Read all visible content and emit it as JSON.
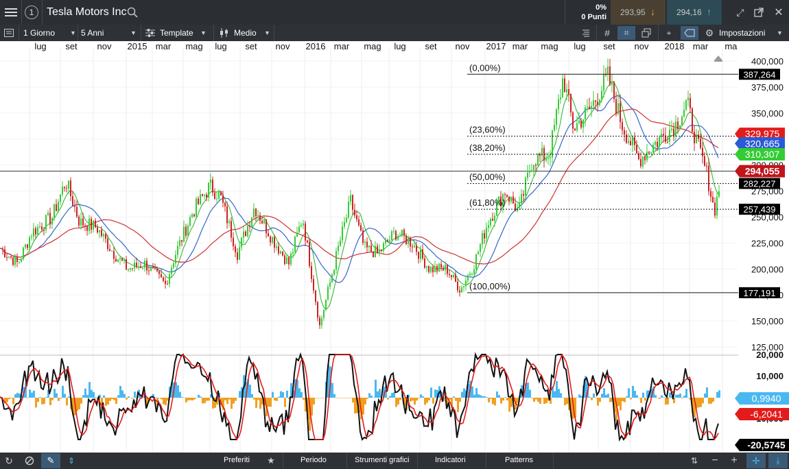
{
  "header": {
    "title": "Tesla Motors Inc",
    "change_pct": "0%",
    "change_pts": "0 Punti",
    "sell": "293,95",
    "buy": "294,16"
  },
  "toolbar": {
    "period": "1 Giorno",
    "range": "5 Anni",
    "template": "Template",
    "style": "Medio",
    "settings": "Impostazioni"
  },
  "bottom": {
    "preferiti": "Preferiti",
    "periodo": "Periodo",
    "strumenti": "Strumenti grafici",
    "indicatori": "Indicatori",
    "patterns": "Patterns"
  },
  "colors": {
    "up": "#33cc33",
    "down": "#cc2222",
    "ma_short": "#44bb44",
    "ma_mid": "#3366cc",
    "ma_long": "#d03030",
    "osc_pos": "#4ab8f0",
    "osc_neg": "#f0a020"
  },
  "chart_data": {
    "type": "candlestick",
    "x_labels": [
      "lug",
      "set",
      "nov",
      "2015",
      "mar",
      "mag",
      "lug",
      "set",
      "nov",
      "2016",
      "mar",
      "mag",
      "lug",
      "set",
      "nov",
      "2017",
      "mar",
      "mag",
      "lug",
      "set",
      "nov",
      "2018",
      "mar",
      "mag"
    ],
    "y_ticks": [
      "400,000",
      "375,000",
      "350,000",
      "325,000",
      "300,000",
      "275,000",
      "250,000",
      "225,000",
      "200,000",
      "175,000",
      "150,000",
      "125,000"
    ],
    "y_range": [
      125000,
      400000
    ],
    "fibonacci": [
      {
        "level": "(0,00%)",
        "price": "387,264"
      },
      {
        "level": "(23,60%)",
        "price": "327,688"
      },
      {
        "level": "(38,20%)",
        "price": "310,307"
      },
      {
        "level": "(50,00%)",
        "price": "282,227"
      },
      {
        "level": "(61,80%)",
        "price": "257,439"
      },
      {
        "level": "(100,00%)",
        "price": "177,191"
      }
    ],
    "price_tags": [
      {
        "value": "329,975",
        "color": "#e31b1b"
      },
      {
        "value": "320,665",
        "color": "#2a5bd7"
      },
      {
        "value": "310,307",
        "color": "#33cc33"
      },
      {
        "value": "294,055",
        "color": "#c0151b"
      }
    ],
    "price_path": [
      [
        0,
        220
      ],
      [
        25,
        205
      ],
      [
        45,
        235
      ],
      [
        75,
        250
      ],
      [
        95,
        285
      ],
      [
        115,
        245
      ],
      [
        140,
        240
      ],
      [
        165,
        215
      ],
      [
        185,
        200
      ],
      [
        210,
        205
      ],
      [
        240,
        185
      ],
      [
        255,
        215
      ],
      [
        280,
        255
      ],
      [
        305,
        280
      ],
      [
        320,
        270
      ],
      [
        345,
        215
      ],
      [
        370,
        260
      ],
      [
        395,
        230
      ],
      [
        420,
        205
      ],
      [
        440,
        250
      ],
      [
        465,
        145
      ],
      [
        490,
        215
      ],
      [
        510,
        265
      ],
      [
        530,
        220
      ],
      [
        550,
        215
      ],
      [
        575,
        235
      ],
      [
        600,
        225
      ],
      [
        625,
        200
      ],
      [
        650,
        200
      ],
      [
        670,
        180
      ],
      [
        690,
        205
      ],
      [
        710,
        245
      ],
      [
        735,
        275
      ],
      [
        755,
        255
      ],
      [
        775,
        305
      ],
      [
        800,
        310
      ],
      [
        820,
        385
      ],
      [
        835,
        335
      ],
      [
        860,
        355
      ],
      [
        885,
        385
      ],
      [
        905,
        340
      ],
      [
        930,
        305
      ],
      [
        960,
        325
      ],
      [
        985,
        340
      ],
      [
        1000,
        360
      ],
      [
        1015,
        320
      ],
      [
        1030,
        290
      ],
      [
        1040,
        255
      ],
      [
        1048,
        280
      ]
    ],
    "osc": {
      "y_ticks": [
        "20,000",
        "10,000",
        "0,000",
        "-10,000"
      ],
      "tags": [
        {
          "value": "0,9940",
          "color": "#4ab8f0"
        },
        {
          "value": "-6,2041",
          "color": "#e31b1b"
        },
        {
          "value": "-20,5745",
          "color": "#000000"
        }
      ]
    }
  }
}
